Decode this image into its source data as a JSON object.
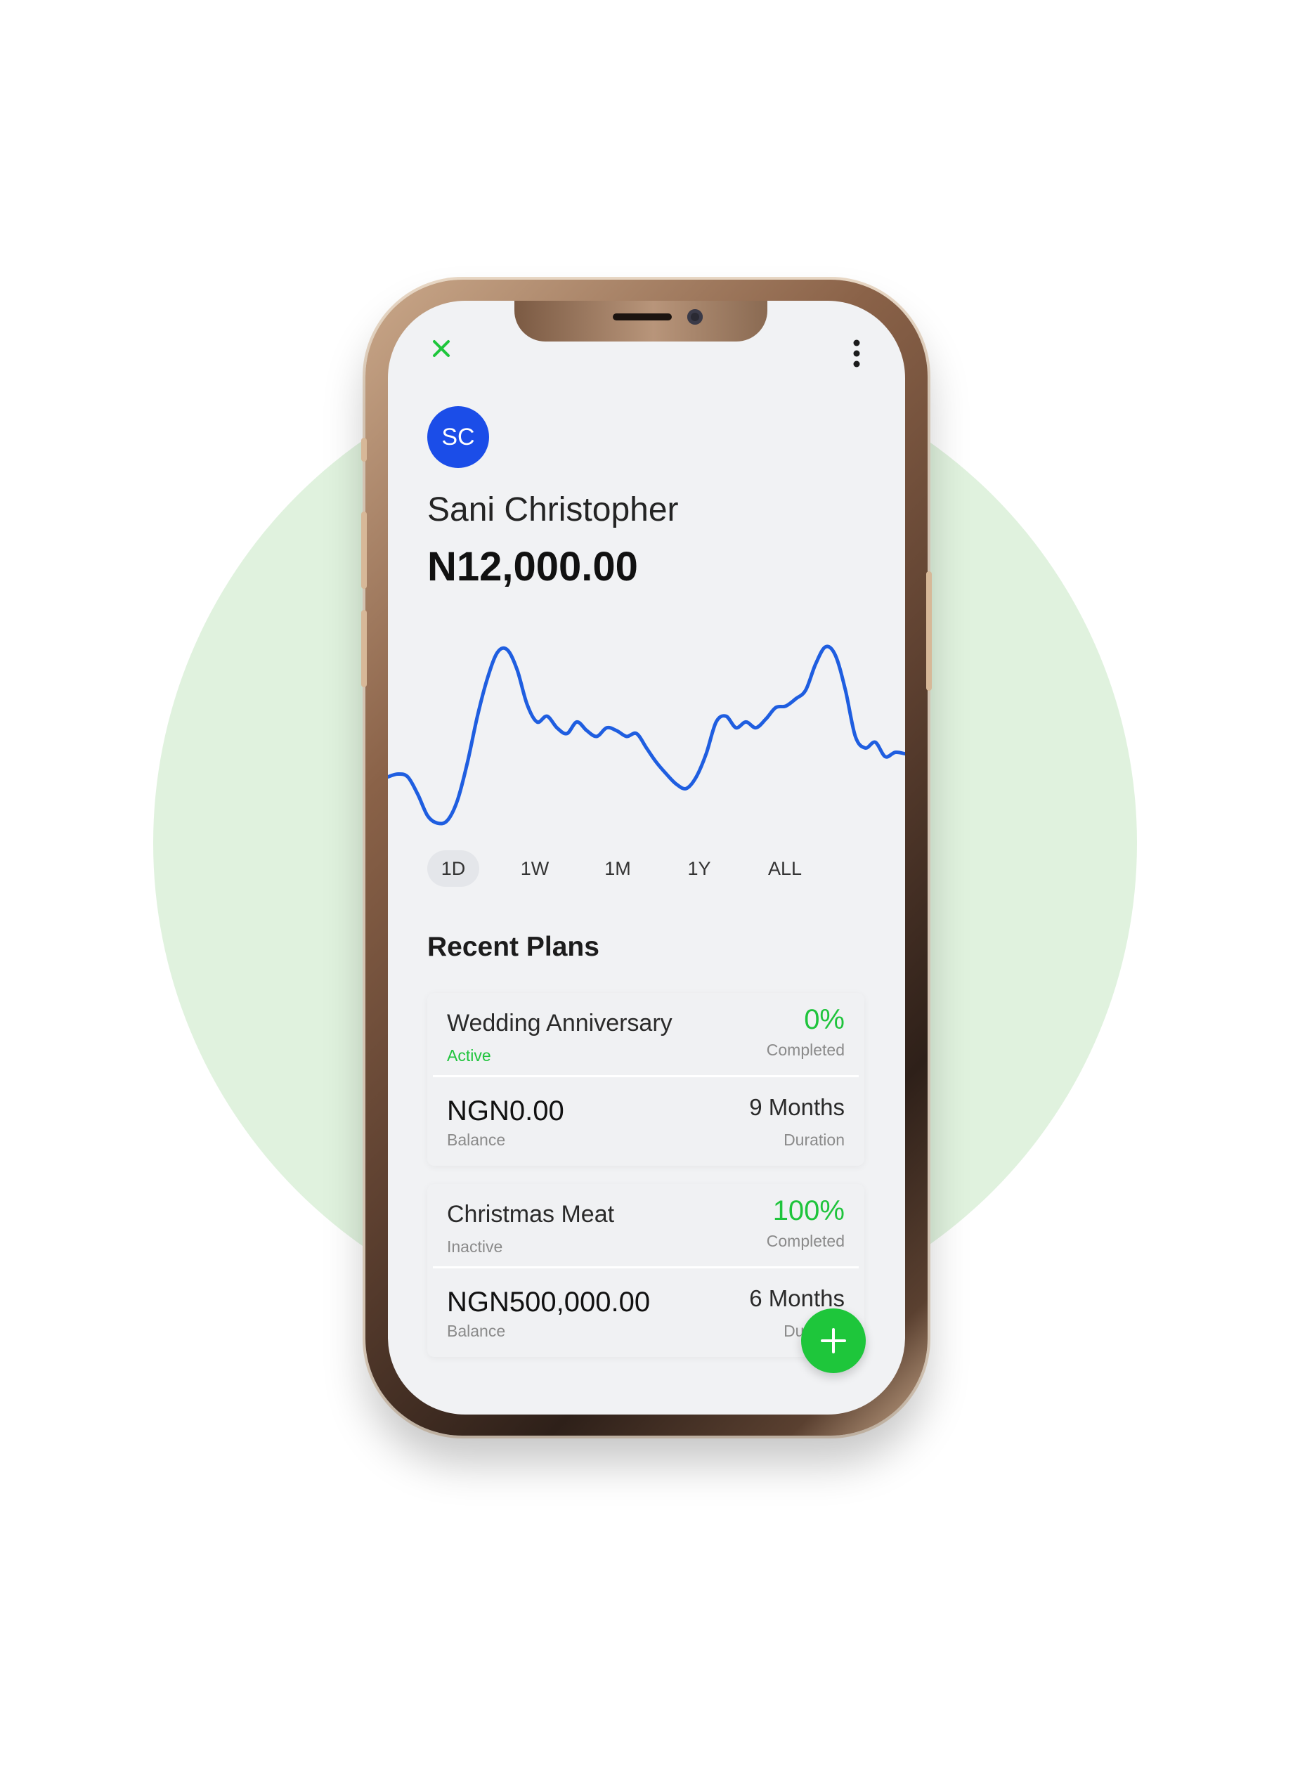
{
  "colors": {
    "accent_green": "#1ec63b",
    "avatar_blue": "#1b4de8",
    "chart_line": "#1f5ee0",
    "background_circle": "#e0f2de"
  },
  "header": {
    "close_icon": "close-icon",
    "more_icon": "more-vertical-icon"
  },
  "profile": {
    "initials": "SC",
    "name": "Sani Christopher",
    "balance": "N12,000.00"
  },
  "chart_data": {
    "type": "line",
    "title": "",
    "xlabel": "",
    "ylabel": "",
    "grid": false,
    "series": [
      {
        "values": [
          42,
          44,
          42,
          30,
          15,
          10,
          12,
          26,
          52,
          84,
          110,
          128,
          130,
          116,
          92,
          80,
          84,
          76,
          72,
          80,
          74,
          70,
          76,
          74,
          70,
          72,
          62,
          52,
          44,
          37,
          34,
          42,
          58,
          80,
          84,
          76,
          80,
          76,
          82,
          90,
          91,
          96,
          102,
          120,
          132,
          126,
          102,
          70,
          62,
          66,
          56,
          59,
          58
        ]
      }
    ]
  },
  "periods": [
    {
      "label": "1D",
      "active": true
    },
    {
      "label": "1W",
      "active": false
    },
    {
      "label": "1M",
      "active": false
    },
    {
      "label": "1Y",
      "active": false
    },
    {
      "label": "ALL",
      "active": false
    }
  ],
  "recent_plans": {
    "title": "Recent Plans",
    "plans": [
      {
        "title": "Wedding Anniversary",
        "status": "Active",
        "status_color": "#1fc43c",
        "percent": "0%",
        "percent_label": "Completed",
        "amount": "NGN0.00",
        "amount_label": "Balance",
        "duration": "9 Months",
        "duration_label": "Duration"
      },
      {
        "title": "Christmas Meat",
        "status": "Inactive",
        "status_color": "#8a8a8a",
        "percent": "100%",
        "percent_label": "Completed",
        "amount": "NGN500,000.00",
        "amount_label": "Balance",
        "duration": "6 Months",
        "duration_label": "Duration"
      }
    ]
  },
  "fab": {
    "icon": "plus-icon"
  }
}
